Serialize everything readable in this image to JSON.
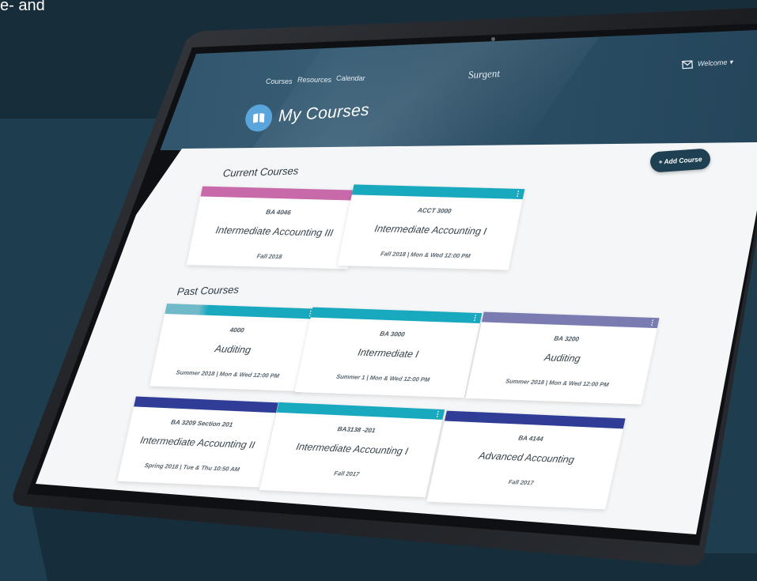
{
  "stray_text": "e- and",
  "nav": {
    "links": [
      "Courses",
      "Resources",
      "Calendar"
    ],
    "brand": "Surgent",
    "welcome": "Welcome ▾"
  },
  "page": {
    "title": "My Courses",
    "add_course": "+ Add Course"
  },
  "sections": {
    "current_title": "Current Courses",
    "past_title": "Past Courses"
  },
  "current_courses": [
    {
      "code": "BA 4046",
      "name": "Intermediate Accounting III",
      "term": "Fall 2018",
      "color": "#c86aa9"
    },
    {
      "code": "ACCT 3000",
      "name": "Intermediate Accounting I",
      "term": "Fall 2018 | Mon & Wed 12:00 PM",
      "color": "#19a9bf"
    }
  ],
  "past_courses": [
    {
      "code": "4000",
      "name": "Auditing",
      "term": "Summer 2018 | Mon & Wed 12:00 PM",
      "color": "#19a9bf"
    },
    {
      "code": "BA 3000",
      "name": "Intermediate I",
      "term": "Summer 1 | Mon & Wed 12:00 PM",
      "color": "#19a9bf"
    },
    {
      "code": "BA 3200",
      "name": "Auditing",
      "term": "Summer 2018 | Mon & Wed 12:00 PM",
      "color": "#7a7bb0"
    },
    {
      "code": "BA 3209 Section 201",
      "name": "Intermediate Accounting II",
      "term": "Spring 2018 | Tue & Thu 10:50 AM",
      "color": "#2f3d96"
    },
    {
      "code": "BA3138 -201",
      "name": "Intermediate Accounting I",
      "term": "Fall 2017",
      "color": "#19a9bf"
    },
    {
      "code": "BA 4144",
      "name": "Advanced Accounting",
      "term": "Fall 2017",
      "color": "#2f3d96"
    }
  ],
  "icons": {
    "mail": "mail-icon",
    "book": "book-icon",
    "kebab": "kebab-menu-icon"
  },
  "colors": {
    "header": "#2a4d64",
    "accent": "#5aa5dc",
    "background": "#1e3d4f"
  }
}
